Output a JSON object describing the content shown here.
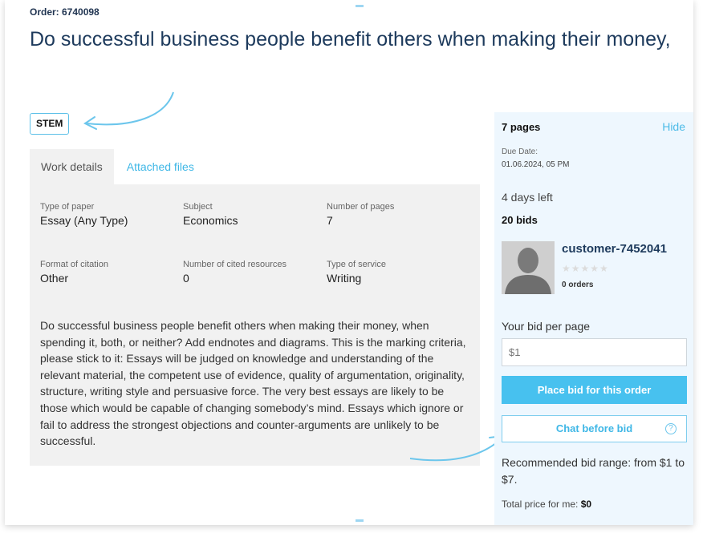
{
  "header": {
    "order_number": "Order: 6740098",
    "title": "Do successful business people benefit others when making their money,",
    "category_tag": "STEM"
  },
  "tabs": [
    {
      "label": "Work details",
      "active": true
    },
    {
      "label": "Attached files",
      "active": false
    }
  ],
  "details": {
    "type_of_paper": {
      "label": "Type of paper",
      "value": "Essay (Any Type)"
    },
    "subject": {
      "label": "Subject",
      "value": "Economics"
    },
    "number_of_pages": {
      "label": "Number of pages",
      "value": "7"
    },
    "format_of_citation": {
      "label": "Format of citation",
      "value": "Other"
    },
    "cited_resources": {
      "label": "Number of cited resources",
      "value": "0"
    },
    "type_of_service": {
      "label": "Type of service",
      "value": "Writing"
    },
    "description": "Do successful business people benefit others when making their money, when spending it, both, or neither? Add endnotes and diagrams. This is the marking criteria, please stick to it: Essays will be judged on knowledge and understanding of the relevant material, the competent use of evidence, quality of argumentation, originality, structure, writing style and persuasive force. The very best essays are likely to be those which would be capable of changing somebody’s mind. Essays which ignore or fail to address the strongest objections and counter-arguments are unlikely to be successful."
  },
  "sidebar": {
    "pages": "7 pages",
    "hide_label": "Hide",
    "due_date_label": "Due Date:",
    "due_date_value": "01.06.2024, 05 PM",
    "days_left": "4 days left",
    "bids_count": "20 bids",
    "customer": {
      "name": "customer-7452041",
      "rating_stars": "★★★★★",
      "orders": "0 orders"
    },
    "bid_label": "Your bid per page",
    "bid_placeholder": "$1",
    "place_bid_button": "Place bid for this order",
    "chat_button": "Chat before bid",
    "help_symbol": "?",
    "recommended_range": "Recommended bid range: from $1 to $7.",
    "total_price_label": "Total price for me:",
    "total_price_value": "$0"
  },
  "colors": {
    "accent": "#47c1ef",
    "title": "#1d3a5c",
    "panel_bg": "#f1f1f1",
    "sidebar_bg": "#eef7fe"
  }
}
